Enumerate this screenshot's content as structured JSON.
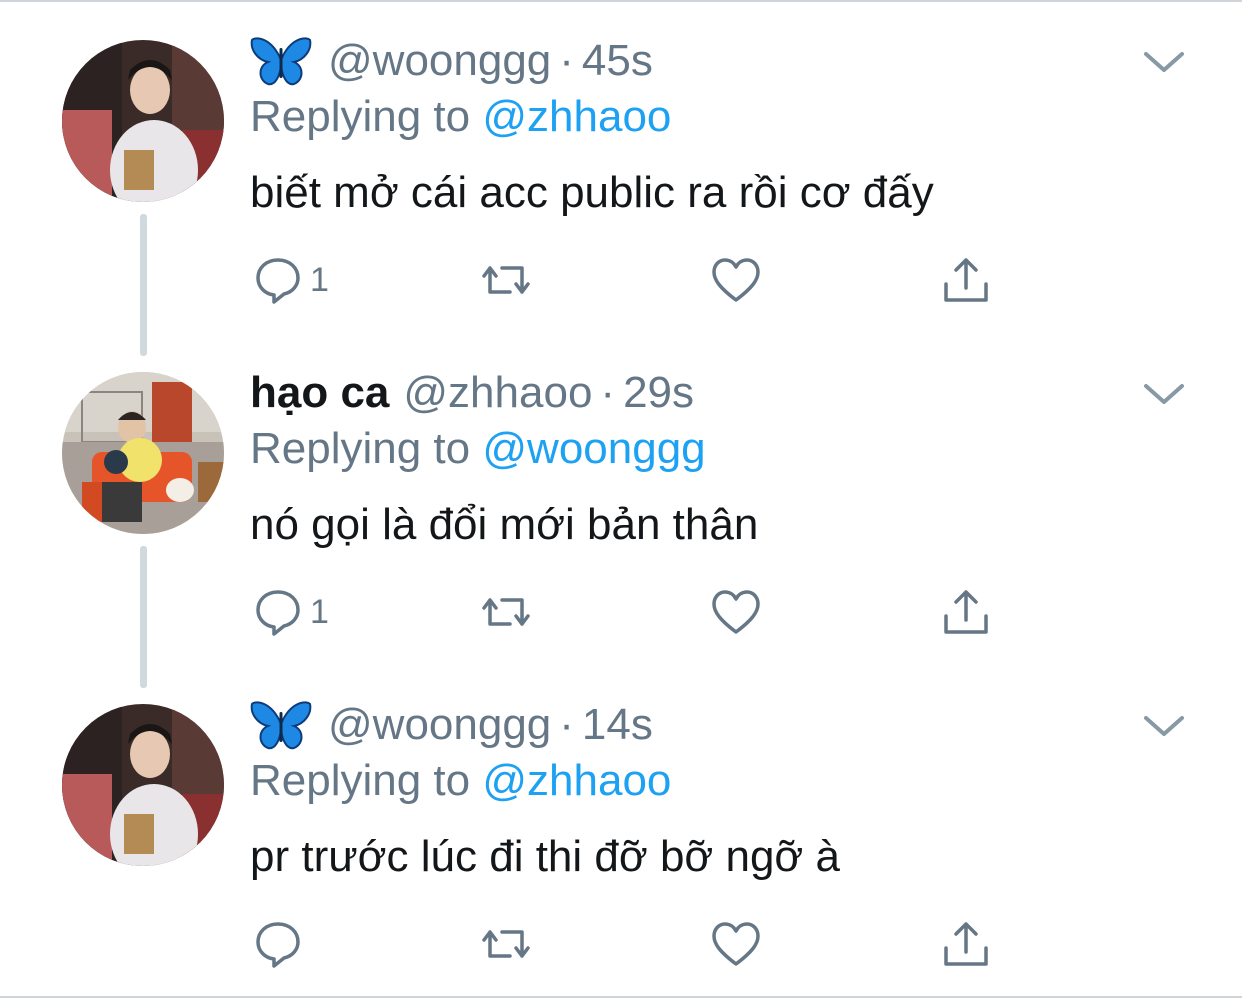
{
  "tweets": [
    {
      "display_name": "",
      "emoji": "blue-butterfly",
      "handle": "@woonggg",
      "time": "45s",
      "replying_label": "Replying to",
      "replying_to": "@zhhaoo",
      "text": "biết mở cái acc public ra rồi cơ đấy",
      "reply_count": "1",
      "avatar": "photo-man-white-hoodie"
    },
    {
      "display_name": "hạo ca",
      "emoji": "",
      "handle": "@zhhaoo",
      "time": "29s",
      "replying_label": "Replying to",
      "replying_to": "@woonggg",
      "text": "nó gọi là đổi mới bản thân",
      "reply_count": "1",
      "avatar": "photo-man-orange-sofa-dog"
    },
    {
      "display_name": "",
      "emoji": "blue-butterfly",
      "handle": "@woonggg",
      "time": "14s",
      "replying_label": "Replying to",
      "replying_to": "@zhhaoo",
      "text": "pr trước lúc đi thi đỡ bỡ ngỡ à",
      "reply_count": "",
      "avatar": "photo-man-white-hoodie"
    }
  ],
  "colors": {
    "link": "#1da1f2",
    "muted": "#657786",
    "text": "#14171a",
    "thread_line": "#cfd9de"
  }
}
